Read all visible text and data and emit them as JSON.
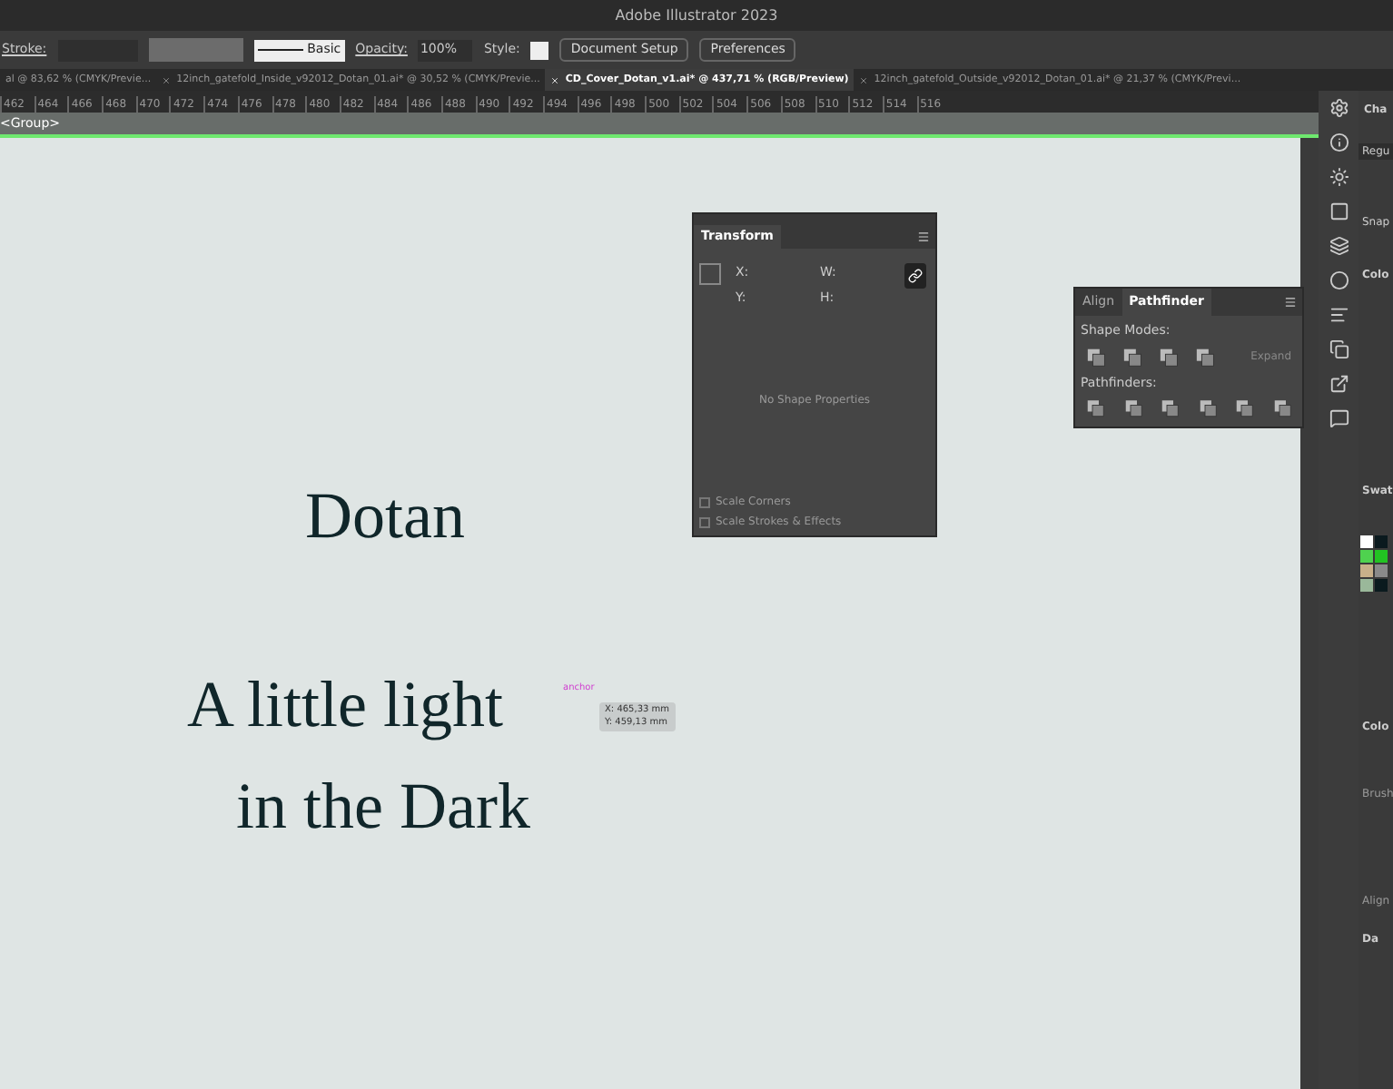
{
  "window": {
    "title": "Adobe Illustrator 2023"
  },
  "control_bar": {
    "stroke_label": "Stroke:",
    "brush_label": "Basic",
    "opacity_label": "Opacity:",
    "opacity_value": "100%",
    "style_label": "Style:",
    "buttons": [
      "Document Setup",
      "Preferences"
    ]
  },
  "tabs": [
    {
      "label": "al @ 83,62 % (CMYK/Previe...",
      "selected": false
    },
    {
      "label": "12inch_gatefold_Inside_v92012_Dotan_01.ai* @ 30,52 % (CMYK/Previe...",
      "selected": false
    },
    {
      "label": "CD_Cover_Dotan_v1.ai* @ 437,71 % (RGB/Preview)",
      "selected": true
    },
    {
      "label": "12inch_gatefold_Outside_v92012_Dotan_01.ai* @ 21,37 % (CMYK/Previ...",
      "selected": false
    }
  ],
  "ruler": [
    "462",
    "464",
    "466",
    "468",
    "470",
    "472",
    "474",
    "476",
    "478",
    "480",
    "482",
    "484",
    "486",
    "488",
    "490",
    "492",
    "494",
    "496",
    "498",
    "500",
    "502",
    "504",
    "506",
    "508",
    "510",
    "512",
    "514",
    "516"
  ],
  "breadcrumb": "<Group>",
  "artwork": {
    "lines": [
      "Dotan",
      "A little light",
      "in the Dark"
    ],
    "anchor_label": "anchor",
    "tooltip": [
      "X: 465,33 mm",
      "Y: 459,13 mm"
    ]
  },
  "transform_panel": {
    "title": "Transform",
    "fields": [
      "X:",
      "W:",
      "Y:",
      "H:"
    ],
    "message": "No Shape Properties",
    "options": [
      {
        "label": "Scale Corners",
        "checked": false
      },
      {
        "label": "Scale Strokes & Effects",
        "checked": false
      }
    ]
  },
  "pathfinder_panel": {
    "tabs": [
      {
        "label": "Align",
        "selected": false
      },
      {
        "label": "Pathfinder",
        "selected": true
      }
    ],
    "shape_modes_label": "Shape Modes:",
    "expand_label": "Expand",
    "pathfinders_label": "Pathfinders:"
  },
  "right_panels": {
    "character": "Cha",
    "font_style": "Regu",
    "snap": "Snap",
    "color_guide": "Colo",
    "swatches": "Swat",
    "color_panel": "Colo",
    "brushes": "Brush",
    "align": "Align",
    "layers": "Da",
    "swatch_colors": [
      {
        "color": "#ffffff"
      },
      {
        "color": "#0b1a1e"
      },
      {
        "color": "#4fd24f"
      },
      {
        "color": "#22c322"
      },
      {
        "color": "#c8b08a"
      },
      {
        "color": "#8a8a8a"
      },
      {
        "color": "#9ab89a"
      },
      {
        "color": "#0b1a1e"
      }
    ]
  }
}
